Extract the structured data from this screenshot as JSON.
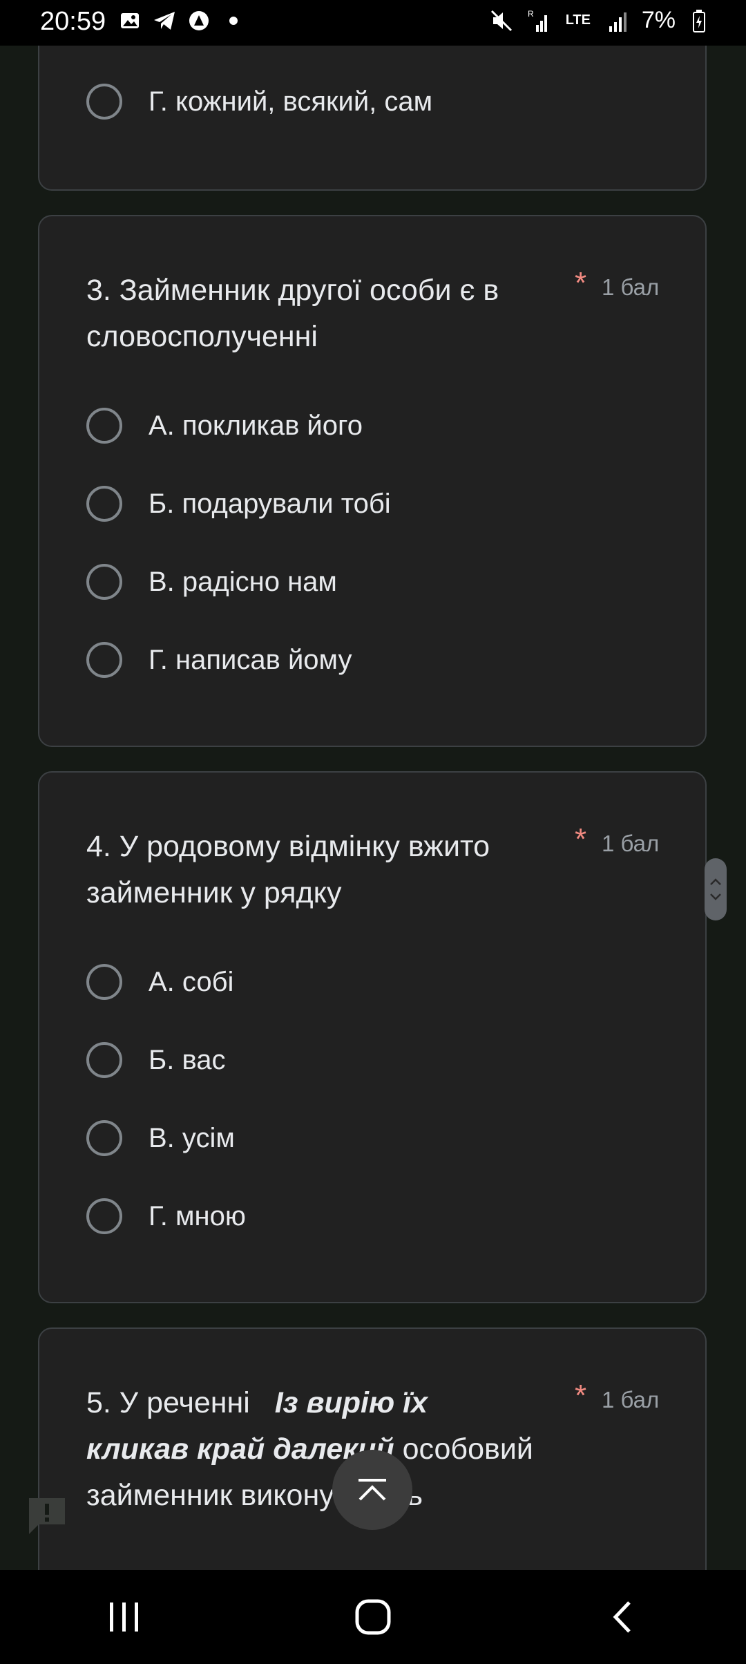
{
  "status_bar": {
    "time": "20:59",
    "battery": "7%",
    "network": "LTE",
    "icons_left": [
      "gallery-icon",
      "telegram-icon",
      "app-icon",
      "dot-icon"
    ],
    "icons_right": [
      "mute-icon",
      "signal-roaming-icon",
      "lte-icon",
      "signal-icon",
      "battery-charging-icon"
    ]
  },
  "colors": {
    "background": "#151a15",
    "card": "#212121",
    "card_border": "#3c4043",
    "required": "#f28b82",
    "muted": "#9aa0a6"
  },
  "question2_partial": {
    "options": [
      {
        "label": "Г. кожний, всякий, сам"
      }
    ]
  },
  "question3": {
    "title": "3. Займенник другої особи є в словосполученні",
    "required_mark": "*",
    "points": "1 бал",
    "options": [
      {
        "label": "А. покликав його"
      },
      {
        "label": "Б. подарували тобі"
      },
      {
        "label": "В. радісно нам"
      },
      {
        "label": "Г. написав йому"
      }
    ]
  },
  "question4": {
    "title": "4. У родовому відмінку вжито займенник у рядку",
    "required_mark": "*",
    "points": "1 бал",
    "options": [
      {
        "label": "А. собі"
      },
      {
        "label": "Б. вас"
      },
      {
        "label": "В. усім"
      },
      {
        "label": "Г. мною"
      }
    ]
  },
  "question5": {
    "title_prefix": "5. У реченні",
    "title_emphasis": "Із вирію їх кликав край далекий",
    "title_suffix": "особовий займенник виконує роль",
    "required_mark": "*",
    "points": "1 бал"
  }
}
